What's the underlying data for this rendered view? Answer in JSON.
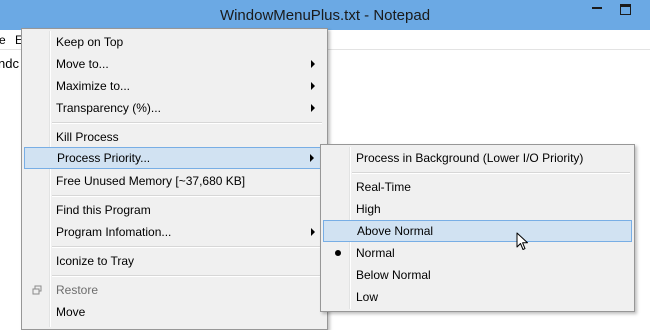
{
  "window": {
    "title": "WindowMenuPlus.txt - Notepad"
  },
  "menubar": {
    "items": [
      "e",
      "E"
    ]
  },
  "editor": {
    "text": "ndc"
  },
  "main_menu": {
    "items": [
      {
        "label": "Keep on Top"
      },
      {
        "label": "Move to..."
      },
      {
        "label": "Maximize to..."
      },
      {
        "label": "Transparency (%)..."
      },
      {
        "label": "Kill Process"
      },
      {
        "label": "Process Priority..."
      },
      {
        "label": "Free Unused Memory [~37,680 KB]"
      },
      {
        "label": "Find this Program"
      },
      {
        "label": "Program Infomation..."
      },
      {
        "label": "Iconize to Tray"
      },
      {
        "label": "Restore"
      },
      {
        "label": "Move"
      }
    ],
    "highlighted": "Process Priority..."
  },
  "priority_menu": {
    "items": [
      {
        "label": "Process in Background (Lower I/O Priority)"
      },
      {
        "label": "Real-Time"
      },
      {
        "label": "High"
      },
      {
        "label": "Above Normal"
      },
      {
        "label": "Normal"
      },
      {
        "label": "Below Normal"
      },
      {
        "label": "Low"
      }
    ],
    "highlighted": "Above Normal",
    "selected": "Normal"
  },
  "colors": {
    "titlebar": "#6ba9e4",
    "menu_background": "#f0f0f0",
    "highlight": "#d1e2f2",
    "highlight_border": "#78aee5"
  }
}
